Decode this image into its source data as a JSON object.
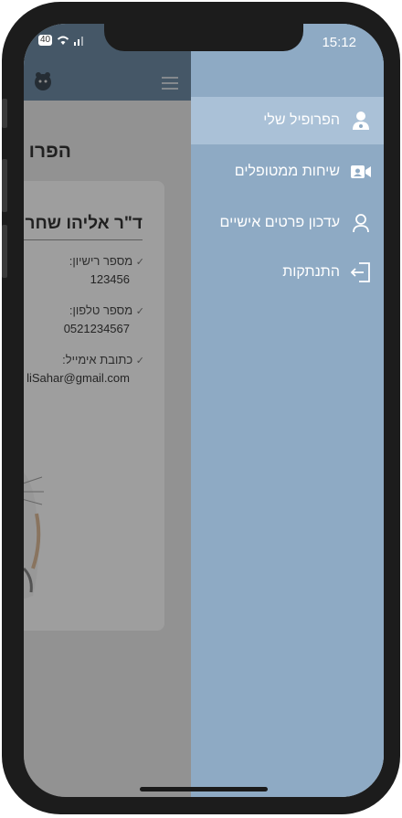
{
  "status_bar": {
    "time": "15:12",
    "battery": "40"
  },
  "page": {
    "title": "הפרו"
  },
  "profile": {
    "name": "ד\"ר אליהו שחר",
    "license_label": "מספר רישיון:",
    "license_value": "123456",
    "phone_label": "מספר טלפון:",
    "phone_value": "0521234567",
    "email_label": "כתובת אימייל:",
    "email_value": "liSahar@gmail.com"
  },
  "menu": {
    "items": [
      {
        "label": "הפרופיל שלי",
        "icon": "doctor-icon",
        "active": true
      },
      {
        "label": "שיחות ממטופלים",
        "icon": "video-call-icon",
        "active": false
      },
      {
        "label": "עדכון פרטים אישיים",
        "icon": "user-outline-icon",
        "active": false
      },
      {
        "label": "התנתקות",
        "icon": "logout-icon",
        "active": false
      }
    ]
  },
  "colors": {
    "drawer": "#8eaac4",
    "drawer_active": "#aac1d7",
    "header": "#5e7e9b"
  }
}
